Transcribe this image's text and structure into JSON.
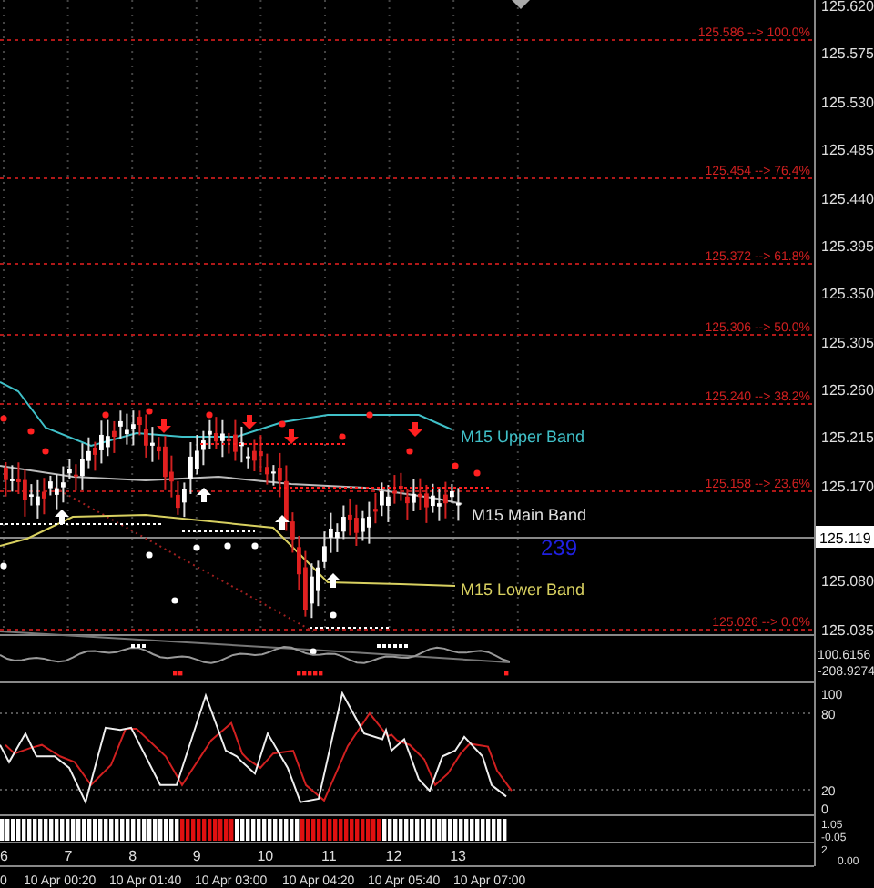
{
  "main_chart": {
    "price_axis": [
      "125.620",
      "125.575",
      "125.530",
      "125.485",
      "125.440",
      "125.395",
      "125.350",
      "125.305",
      "125.260",
      "125.215",
      "125.170",
      "125.080",
      "125.035"
    ],
    "current_price": "125.119",
    "fib_levels": [
      {
        "label": "125.586 --> 100.0%"
      },
      {
        "label": "125.454 --> 76.4%"
      },
      {
        "label": "125.372 --> 61.8%"
      },
      {
        "label": "125.306 --> 50.0%"
      },
      {
        "label": "125.240 --> 38.2%"
      },
      {
        "label": "125.158 --> 23.6%"
      },
      {
        "label": "125.026 --> 0.0%"
      }
    ],
    "band_labels": [
      {
        "text": "M15 Upper Band",
        "color": "#40c0c8"
      },
      {
        "text": "M15 Main Band",
        "color": "#e0e0e0"
      },
      {
        "text": "M15 Lower Band",
        "color": "#d8d060"
      }
    ],
    "counter": "239"
  },
  "oscillator_panel": {
    "scale": [
      "100.6156",
      "-208.9274"
    ]
  },
  "stochastic_panel": {
    "scale": [
      "100",
      "80",
      "20",
      "0"
    ]
  },
  "histogram_panel": {
    "scale": [
      "1.05",
      "-0.05"
    ]
  },
  "bar_index_panel": {
    "bar_numbers": [
      "6",
      "7",
      "8",
      "9",
      "10",
      "11",
      "12",
      "13"
    ],
    "scale": [
      "2",
      "0.00"
    ]
  },
  "time_axis": [
    "0",
    "10 Apr 00:20",
    "10 Apr 01:40",
    "10 Apr 03:00",
    "10 Apr 04:20",
    "10 Apr 05:40",
    "10 Apr 07:00"
  ]
}
